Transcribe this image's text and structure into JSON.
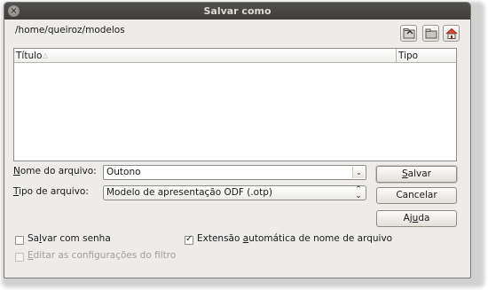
{
  "window": {
    "title": "Salvar como",
    "close_glyph": "×"
  },
  "path": "/home/queiroz/modelos",
  "toolbar": {
    "icons": [
      "go-up-folder-icon",
      "new-folder-icon",
      "home-folder-icon"
    ]
  },
  "file_list": {
    "columns": [
      "Título",
      "Tipo"
    ],
    "sort_indicator": "△",
    "rows": []
  },
  "fields": {
    "name_label_pre": "",
    "name_label_key": "N",
    "name_label_post": "ome do arquivo:",
    "name_value": "Outono",
    "type_label_pre": "",
    "type_label_key": "T",
    "type_label_post": "ipo de arquivo:",
    "type_value": "Modelo de apresentação ODF (.otp)"
  },
  "buttons": {
    "save_pre": "",
    "save_key": "S",
    "save_post": "alvar",
    "cancel": "Cancelar",
    "help_pre": "Aj",
    "help_key": "u",
    "help_post": "da"
  },
  "options": {
    "password_pre": "Sa",
    "password_key": "l",
    "password_post": "var com senha",
    "password_checked": false,
    "ext_pre": "Extensão ",
    "ext_key": "a",
    "ext_post": "utomática de nome de arquivo",
    "ext_checked": true,
    "filter_pre": "",
    "filter_key": "E",
    "filter_post": "ditar as configurações do filtro",
    "filter_checked": false,
    "filter_enabled": false
  },
  "colors": {
    "titlebar": "#3f3e3a",
    "window_bg": "#edecea",
    "disabled_text": "#a3a09a"
  }
}
